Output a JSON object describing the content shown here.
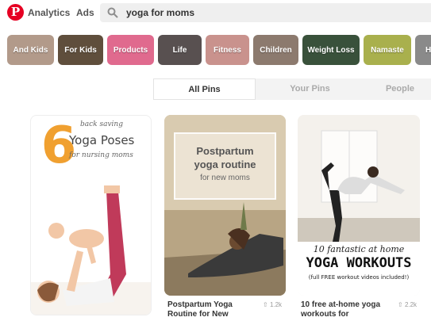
{
  "header": {
    "logo_letter": "P",
    "nav": [
      "Analytics",
      "Ads"
    ],
    "search": {
      "query": "yoga for moms"
    }
  },
  "chips": [
    {
      "label": "And Kids",
      "color": "#b29a8a"
    },
    {
      "label": "For Kids",
      "color": "#5f4e3c"
    },
    {
      "label": "Products",
      "color": "#e06a8e"
    },
    {
      "label": "Life",
      "color": "#585050"
    },
    {
      "label": "Fitness",
      "color": "#c9928d"
    },
    {
      "label": "Children",
      "color": "#8c7a6e"
    },
    {
      "label": "Weight Loss",
      "color": "#39513b"
    },
    {
      "label": "Namaste",
      "color": "#a9b04d"
    },
    {
      "label": "H",
      "color": "#8a8a8a"
    }
  ],
  "tabs": [
    {
      "label": "All Pins",
      "active": true
    },
    {
      "label": "Your Pins",
      "active": false
    },
    {
      "label": "People",
      "active": false
    }
  ],
  "pins": [
    {
      "image_text": {
        "number": "6",
        "line1": "back saving",
        "line2": "Yoga Poses",
        "line3": "for nursing moms"
      },
      "title": "",
      "saves": ""
    },
    {
      "image_text": {
        "line1": "Postpartum",
        "line2": "yoga routine",
        "line3": "for new moms"
      },
      "title": "Postpartum Yoga Routine for New",
      "saves": "1.2k"
    },
    {
      "image_text": {
        "line1": "10 fantastic at home",
        "line2": "YOGA WORKOUTS",
        "line3": "(full FREE workout videos included!)"
      },
      "title": "10 free at-home yoga workouts for",
      "saves": "2.2k"
    }
  ],
  "colors": {
    "brand": "#e60023",
    "accent_orange": "#f0a030",
    "pink_pants": "#c03a5a"
  }
}
